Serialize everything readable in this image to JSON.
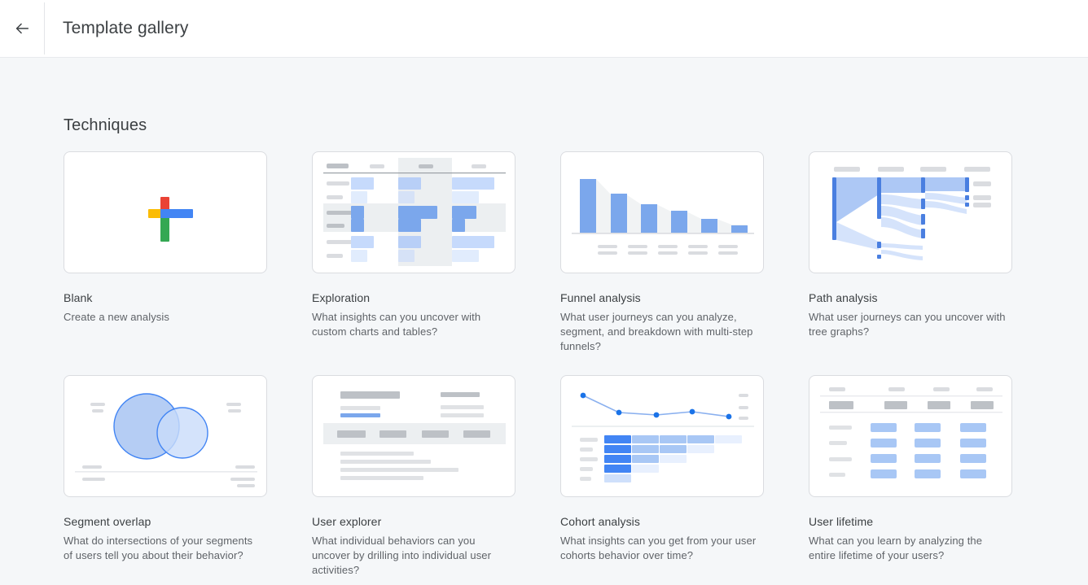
{
  "header": {
    "back_icon": "arrow-left-icon",
    "title": "Template gallery"
  },
  "main": {
    "section_title": "Techniques",
    "cards": [
      {
        "id": "blank",
        "title": "Blank",
        "description": "Create a new analysis",
        "thumb_type": "google-plus"
      },
      {
        "id": "exploration",
        "title": "Exploration",
        "description": "What insights can you uncover with custom charts and tables?",
        "thumb_type": "table-heatmap"
      },
      {
        "id": "funnel-analysis",
        "title": "Funnel analysis",
        "description": "What user journeys can you analyze, segment, and breakdown with multi-step funnels?",
        "thumb_type": "funnel-bars"
      },
      {
        "id": "path-analysis",
        "title": "Path analysis",
        "description": "What user journeys can you uncover with tree graphs?",
        "thumb_type": "sankey"
      },
      {
        "id": "segment-overlap",
        "title": "Segment overlap",
        "description": "What do intersections of your segments of users tell you about their behavior?",
        "thumb_type": "venn"
      },
      {
        "id": "user-explorer",
        "title": "User explorer",
        "description": "What individual behaviors can you uncover by drilling into individual user activities?",
        "thumb_type": "document"
      },
      {
        "id": "cohort-analysis",
        "title": "Cohort analysis",
        "description": "What insights can you get from your user cohorts behavior over time?",
        "thumb_type": "line-cohort"
      },
      {
        "id": "user-lifetime",
        "title": "User lifetime",
        "description": "What can you learn by analyzing the entire lifetime of your users?",
        "thumb_type": "blue-table"
      }
    ]
  },
  "colors": {
    "page_background": "#f5f7f9",
    "surface": "#ffffff",
    "border": "#dadce0",
    "text_primary": "#3c4043",
    "text_secondary": "#5f6368",
    "blue_strong": "#4285f4",
    "blue_medium": "#7ba7ec",
    "blue_light": "#a8c7f5",
    "blue_faint": "#e8f0fe",
    "gray_fill": "#f1f3f4",
    "gray_chip": "#dadce0",
    "gray_chip_dark": "#bdc1c6",
    "google_red": "#ea4335",
    "google_yellow": "#fbbc04",
    "google_green": "#34a853",
    "google_blue": "#4285f4"
  }
}
